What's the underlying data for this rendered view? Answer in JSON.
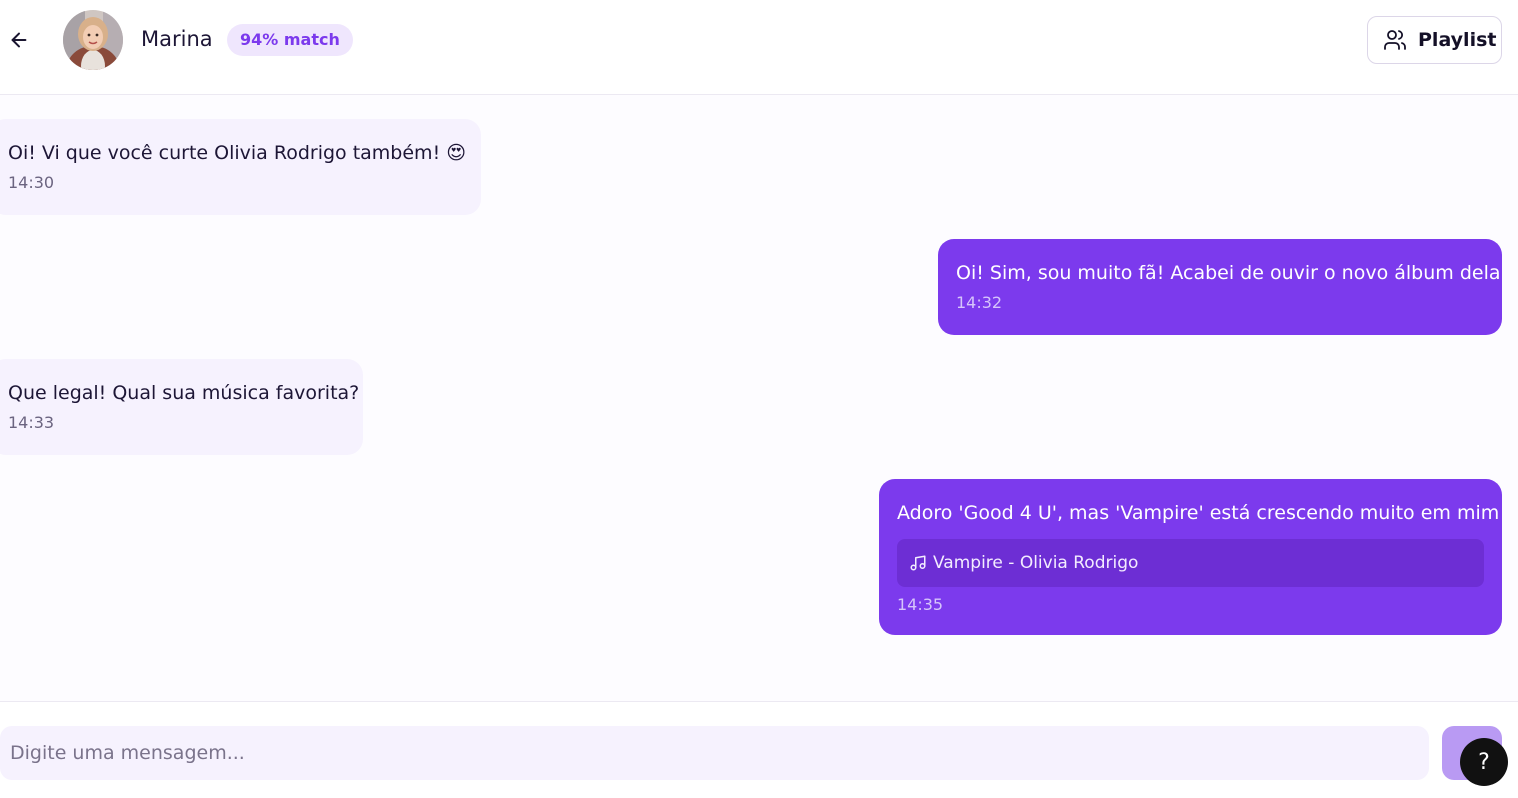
{
  "header": {
    "contact_name": "Marina",
    "match_badge": "94% match",
    "playlist_label": "Playlist"
  },
  "messages": [
    {
      "direction": "incoming",
      "text": "Oi! Vi que você curte Olivia Rodrigo também! 😍",
      "time": "14:30"
    },
    {
      "direction": "outgoing",
      "text": "Oi! Sim, sou muito fã! Acabei de ouvir o novo álbum dela",
      "time": "14:32"
    },
    {
      "direction": "incoming",
      "text": "Que legal! Qual sua música favorita?",
      "time": "14:33"
    },
    {
      "direction": "outgoing",
      "text": "Adoro 'Good 4 U', mas 'Vampire' está crescendo muito em mim",
      "song": "Vampire - Olivia Rodrigo",
      "time": "14:35"
    }
  ],
  "composer": {
    "placeholder": "Digite uma mensagem...",
    "help_label": "?"
  },
  "icons": {
    "back": "arrow-left-icon",
    "playlist": "users-icon",
    "song": "music-note-icon"
  },
  "colors": {
    "accent": "#7c3aed",
    "incoming_bubble": "#f6f2fe",
    "badge_bg": "#efe6fd"
  }
}
